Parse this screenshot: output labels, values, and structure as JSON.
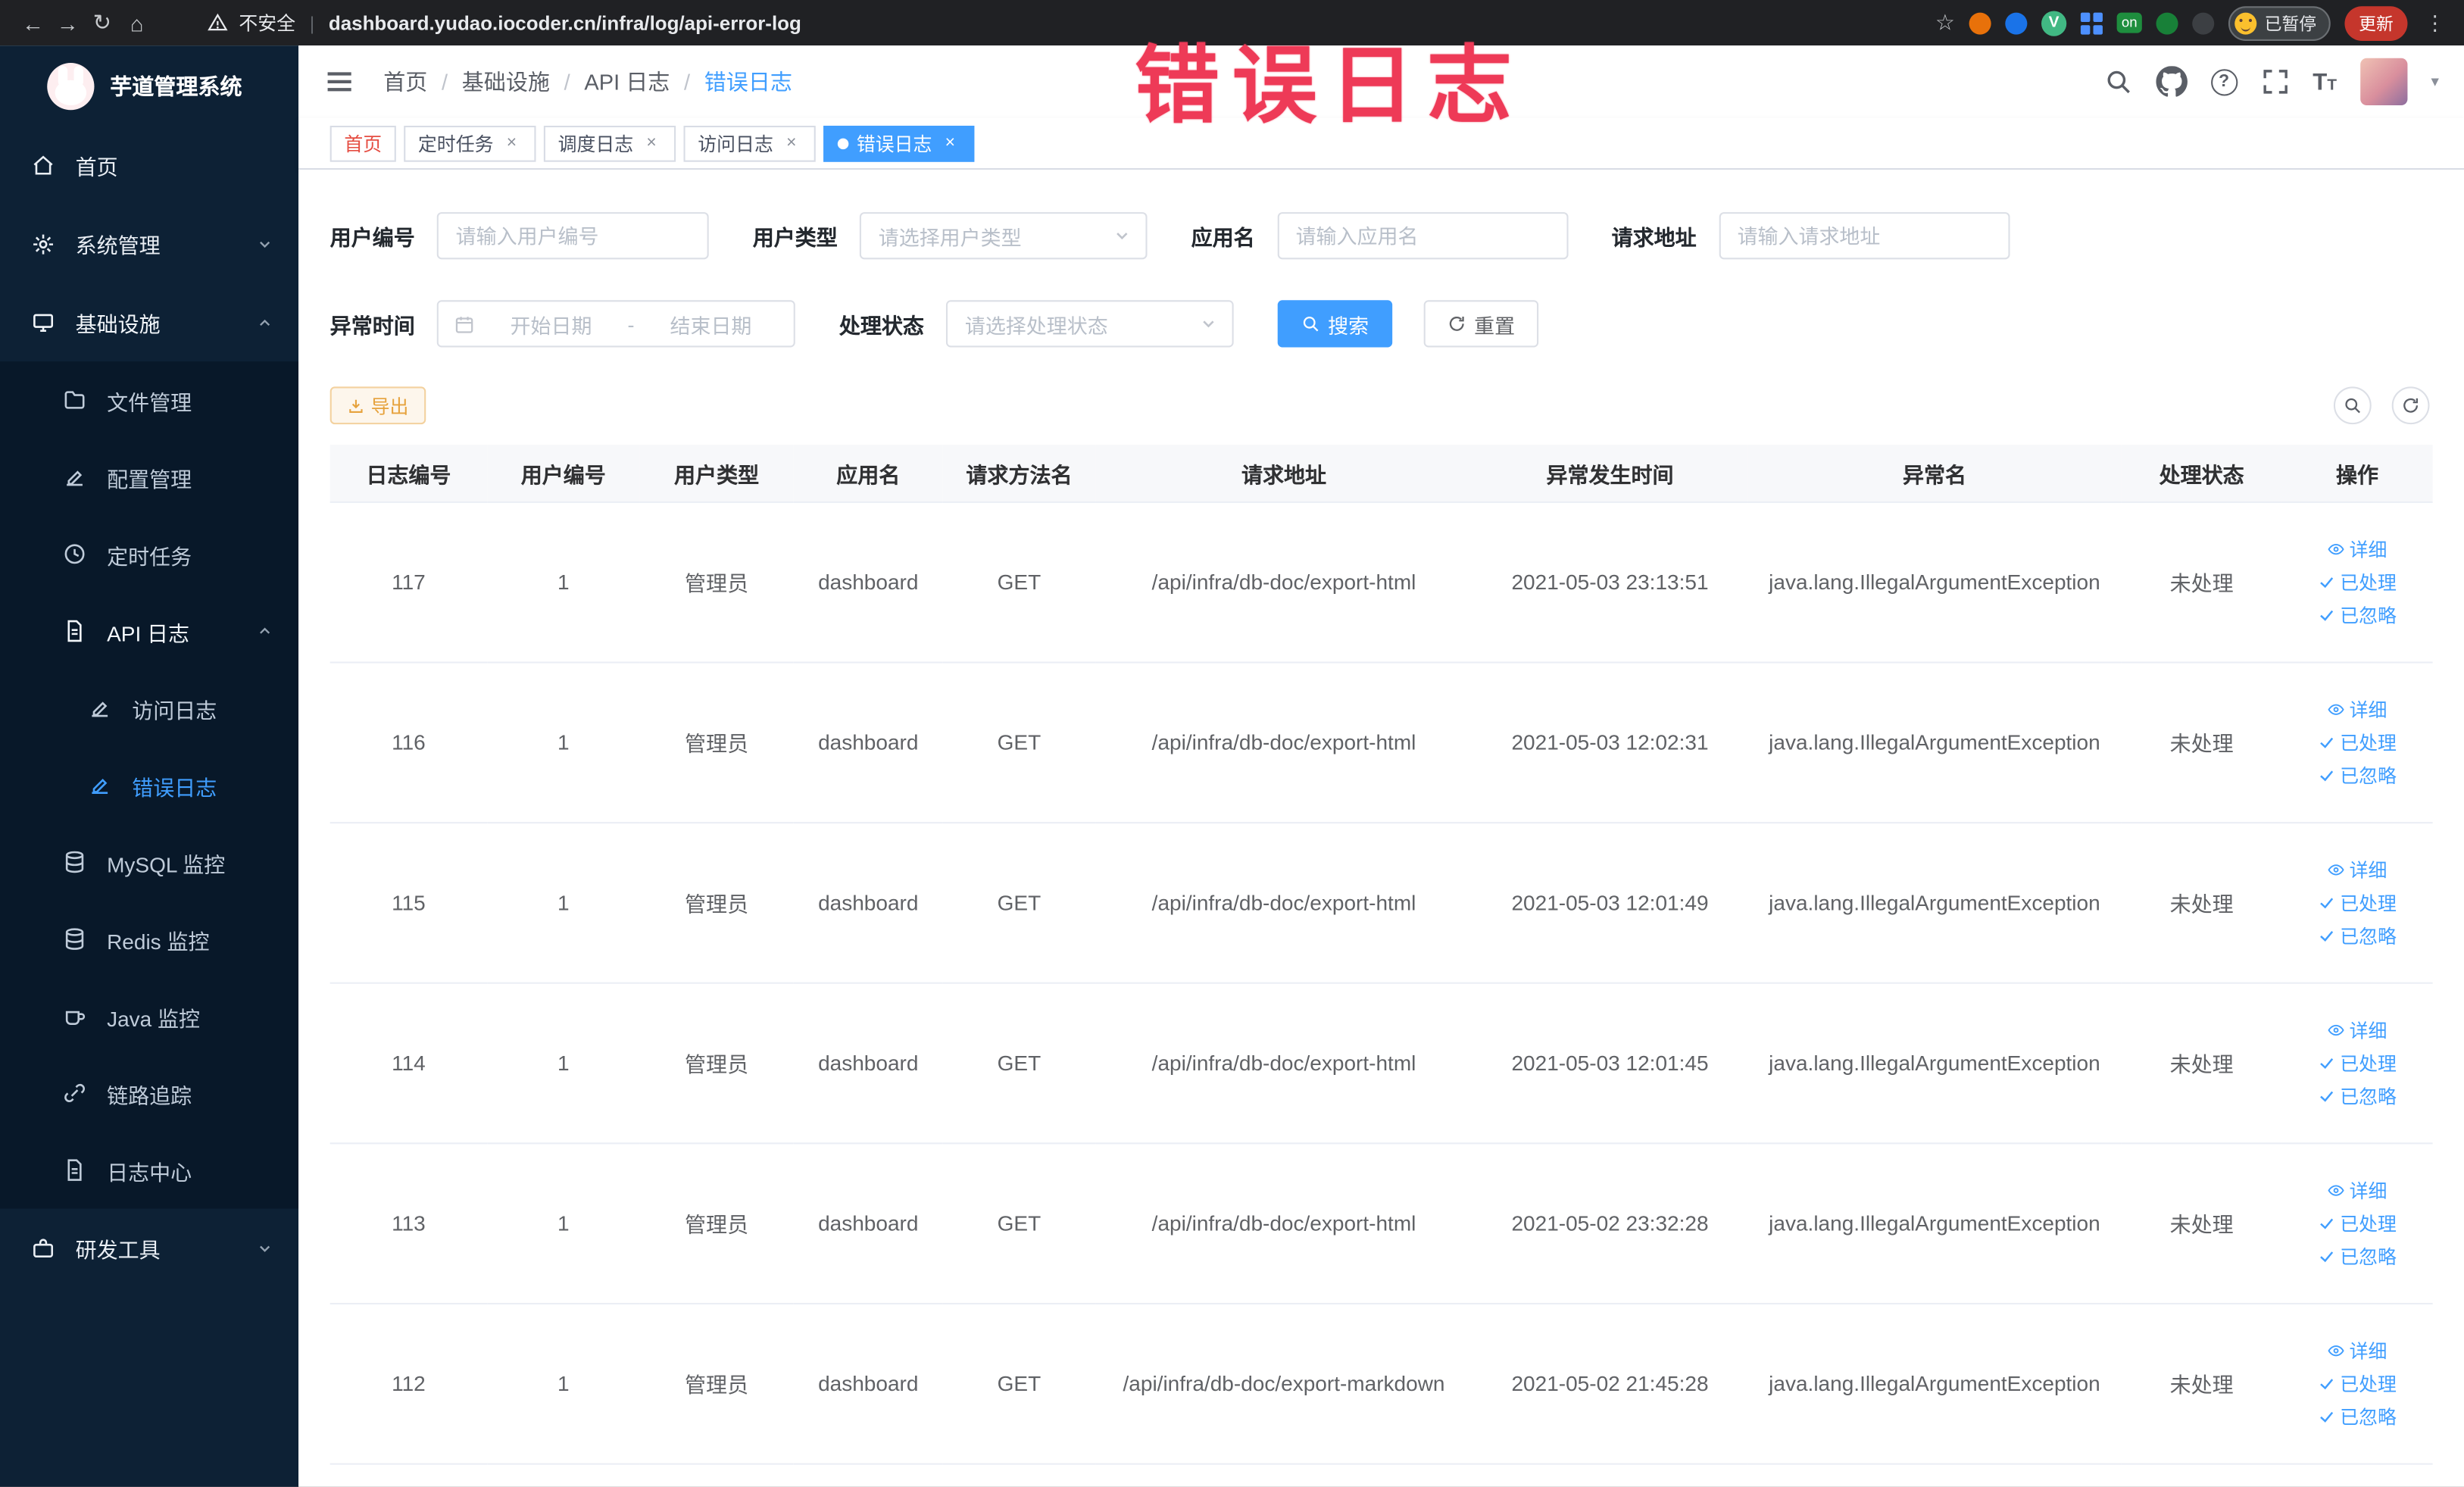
{
  "browser": {
    "security_label": "不安全",
    "url": "dashboard.yudao.iocoder.cn/infra/log/api-error-log",
    "extension_on_badge": "on",
    "paused_badge": "已暂停",
    "update_button": "更新"
  },
  "icons": {
    "back": "←",
    "forward": "→",
    "reload": "↻",
    "home": "⌂",
    "star": "☆",
    "divider": "|",
    "kebab": "⋮",
    "caret": "▾",
    "close": "×",
    "question": "?",
    "font_size_big": "T",
    "font_size_small": "T"
  },
  "overlay": {
    "watermark": "错误日志"
  },
  "sidebar": {
    "logo_title": "芋道管理系统",
    "menu": [
      {
        "label": "首页"
      },
      {
        "label": "系统管理"
      },
      {
        "label": "基础设施"
      },
      {
        "label": "文件管理"
      },
      {
        "label": "配置管理"
      },
      {
        "label": "定时任务"
      },
      {
        "label": "API 日志"
      },
      {
        "label": "访问日志"
      },
      {
        "label": "错误日志"
      },
      {
        "label": "MySQL 监控"
      },
      {
        "label": "Redis 监控"
      },
      {
        "label": "Java 监控"
      },
      {
        "label": "链路追踪"
      },
      {
        "label": "日志中心"
      },
      {
        "label": "研发工具"
      }
    ]
  },
  "header": {
    "breadcrumb": [
      "首页",
      "基础设施",
      "API 日志",
      "错误日志"
    ],
    "breadcrumb_separator": "/"
  },
  "tabs": [
    {
      "label": "首页"
    },
    {
      "label": "定时任务"
    },
    {
      "label": "调度日志"
    },
    {
      "label": "访问日志"
    },
    {
      "label": "错误日志"
    }
  ],
  "filters": {
    "user_id_label": "用户编号",
    "user_id_placeholder": "请输入用户编号",
    "user_type_label": "用户类型",
    "user_type_placeholder": "请选择用户类型",
    "app_name_label": "应用名",
    "app_name_placeholder": "请输入应用名",
    "request_url_label": "请求地址",
    "request_url_placeholder": "请输入请求地址",
    "time_label": "异常时间",
    "time_start_placeholder": "开始日期",
    "time_separator": "-",
    "time_end_placeholder": "结束日期",
    "status_label": "处理状态",
    "status_placeholder": "请选择处理状态",
    "search_button": "搜索",
    "reset_button": "重置"
  },
  "toolbar": {
    "export_button": "导出"
  },
  "table": {
    "columns": [
      "日志编号",
      "用户编号",
      "用户类型",
      "应用名",
      "请求方法名",
      "请求地址",
      "异常发生时间",
      "异常名",
      "处理状态",
      "操作"
    ],
    "actions": [
      "详细",
      "已处理",
      "已忽略"
    ],
    "rows": [
      {
        "id": "117",
        "user_id": "1",
        "user_type": "管理员",
        "app": "dashboard",
        "method": "GET",
        "url": "/api/infra/db-doc/export-html",
        "time": "2021-05-03 23:13:51",
        "exception": "java.lang.IllegalArgumentException",
        "status": "未处理"
      },
      {
        "id": "116",
        "user_id": "1",
        "user_type": "管理员",
        "app": "dashboard",
        "method": "GET",
        "url": "/api/infra/db-doc/export-html",
        "time": "2021-05-03 12:02:31",
        "exception": "java.lang.IllegalArgumentException",
        "status": "未处理"
      },
      {
        "id": "115",
        "user_id": "1",
        "user_type": "管理员",
        "app": "dashboard",
        "method": "GET",
        "url": "/api/infra/db-doc/export-html",
        "time": "2021-05-03 12:01:49",
        "exception": "java.lang.IllegalArgumentException",
        "status": "未处理"
      },
      {
        "id": "114",
        "user_id": "1",
        "user_type": "管理员",
        "app": "dashboard",
        "method": "GET",
        "url": "/api/infra/db-doc/export-html",
        "time": "2021-05-03 12:01:45",
        "exception": "java.lang.IllegalArgumentException",
        "status": "未处理"
      },
      {
        "id": "113",
        "user_id": "1",
        "user_type": "管理员",
        "app": "dashboard",
        "method": "GET",
        "url": "/api/infra/db-doc/export-html",
        "time": "2021-05-02 23:32:28",
        "exception": "java.lang.IllegalArgumentException",
        "status": "未处理"
      },
      {
        "id": "112",
        "user_id": "1",
        "user_type": "管理员",
        "app": "dashboard",
        "method": "GET",
        "url": "/api/infra/db-doc/export-markdown",
        "time": "2021-05-02 21:45:28",
        "exception": "java.lang.IllegalArgumentException",
        "status": "未处理"
      }
    ]
  },
  "colors": {
    "primary": "#409eff",
    "warning": "#e6a23c",
    "watermark_red": "#ee3a57",
    "sidebar_bg": "#0d2135",
    "sidebar_submenu_bg": "#081829",
    "chrome_bg": "#202124",
    "home_tab_red": "#e54d42"
  }
}
